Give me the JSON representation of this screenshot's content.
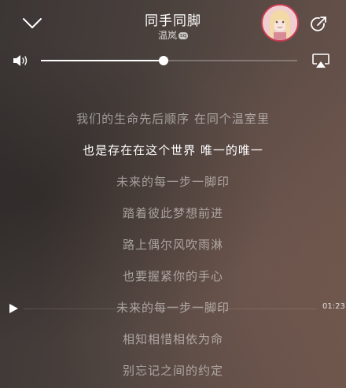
{
  "header": {
    "title": "同手同脚",
    "artist": "温岚",
    "quality_badge": "sq"
  },
  "volume": {
    "level": 0.48
  },
  "lyrics": {
    "lines": [
      "我们的生命先后顺序 在同个温室里",
      "也是存在在这个世界 唯一的唯一",
      "未来的每一步一脚印",
      "踏着彼此梦想前进",
      "路上偶尔风吹雨淋",
      "也要握紧你的手心",
      "未来的每一步一脚印",
      "相知相惜相依为命",
      "别忘记之间的约定"
    ],
    "current_index": 1
  },
  "seek": {
    "time": "01:23"
  },
  "icons": {
    "collapse": "chevron-down-icon",
    "share": "share-icon",
    "volume": "speaker-icon",
    "airplay": "airplay-icon",
    "play": "play-icon"
  }
}
